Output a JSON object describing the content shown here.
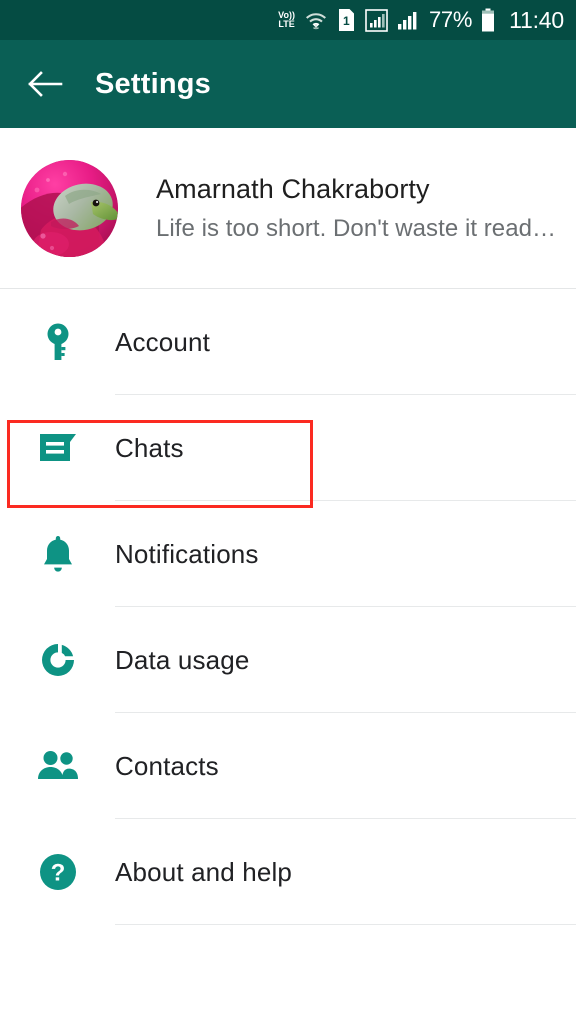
{
  "status_bar": {
    "network_label_top": "Vo))",
    "network_label_bottom": "LTE",
    "icons": [
      "volte-icon",
      "wifi-icon",
      "sim1-icon",
      "signal-bars-icon",
      "signal-bars-2-icon",
      "battery-icon"
    ],
    "battery_percent": "77%",
    "time": "11:40",
    "background_color": "#054C43"
  },
  "app_bar": {
    "back_icon": "back-arrow-icon",
    "title": "Settings",
    "background_color": "#0A5F55"
  },
  "profile": {
    "avatar_icon": "profile-avatar",
    "name": "Amarnath Chakraborty",
    "status": "Life is too short. Don't waste it read…"
  },
  "settings": {
    "accent_color": "#0E9384",
    "items": [
      {
        "label": "Account",
        "icon": "key-icon",
        "highlighted": false
      },
      {
        "label": "Chats",
        "icon": "chat-bubble-icon",
        "highlighted": true
      },
      {
        "label": "Notifications",
        "icon": "bell-icon",
        "highlighted": false
      },
      {
        "label": "Data usage",
        "icon": "data-usage-icon",
        "highlighted": false
      },
      {
        "label": "Contacts",
        "icon": "contacts-icon",
        "highlighted": false
      },
      {
        "label": "About and help",
        "icon": "help-circle-icon",
        "highlighted": false
      }
    ]
  },
  "annotation": {
    "highlight_color": "#FB2A21",
    "target": "Chats"
  }
}
